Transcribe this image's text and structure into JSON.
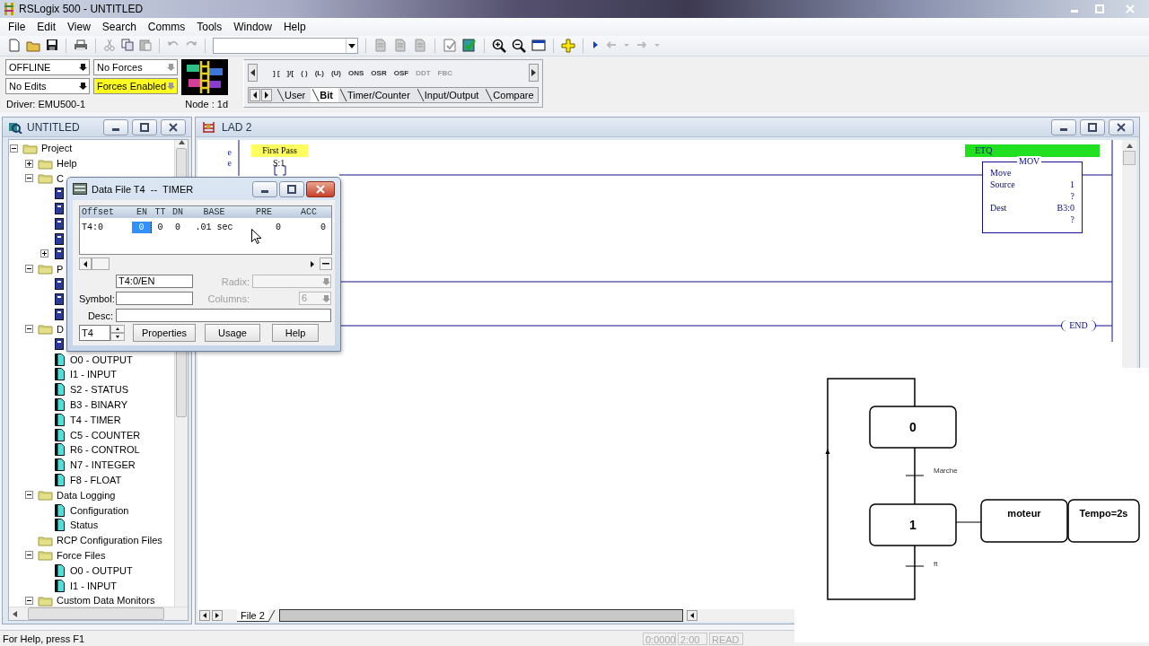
{
  "window": {
    "title": "RSLogix 500 - UNTITLED"
  },
  "menu": [
    "File",
    "Edit",
    "View",
    "Search",
    "Comms",
    "Tools",
    "Window",
    "Help"
  ],
  "status_panel": {
    "dropdowns": [
      {
        "value": "OFFLINE",
        "disabled": false,
        "highlighted": false
      },
      {
        "value": "No Forces",
        "disabled": true,
        "highlighted": false
      },
      {
        "value": "No Edits",
        "disabled": false,
        "highlighted": false
      },
      {
        "value": "Forces Enabled",
        "disabled": true,
        "highlighted": true
      }
    ],
    "driver": "Driver: EMU500-1",
    "node": "Node : 1d"
  },
  "palette": {
    "instructions": [
      {
        "label": "] [",
        "disabled": false
      },
      {
        "label": "]/[",
        "disabled": false
      },
      {
        "label": "( )",
        "disabled": false
      },
      {
        "label": "(L)",
        "disabled": false
      },
      {
        "label": "(U)",
        "disabled": false
      },
      {
        "label": "ONS",
        "disabled": false
      },
      {
        "label": "OSR",
        "disabled": false
      },
      {
        "label": "OSF",
        "disabled": false
      },
      {
        "label": "DDT",
        "disabled": true
      },
      {
        "label": "FBC",
        "disabled": true
      }
    ],
    "tabs": [
      {
        "label": "User",
        "selected": false
      },
      {
        "label": "Bit",
        "selected": true
      },
      {
        "label": "Timer/Counter",
        "selected": false
      },
      {
        "label": "Input/Output",
        "selected": false
      },
      {
        "label": "Compare",
        "selected": false
      }
    ]
  },
  "project_window": {
    "title": "UNTITLED",
    "tree": [
      {
        "label": "Project",
        "kind": "folder",
        "expanded": true,
        "children": [
          {
            "label": "Help",
            "kind": "folder",
            "expanded": false
          },
          {
            "label": "C",
            "kind": "folder",
            "expanded": true,
            "children": [
              {
                "kind": "item"
              },
              {
                "kind": "item"
              },
              {
                "kind": "item"
              },
              {
                "kind": "item"
              },
              {
                "kind": "item",
                "expanded": false
              }
            ]
          },
          {
            "label": "P",
            "kind": "folder",
            "expanded": true,
            "children": [
              {
                "kind": "item"
              },
              {
                "kind": "item"
              },
              {
                "kind": "item"
              }
            ]
          },
          {
            "label": "D",
            "kind": "folder",
            "expanded": true,
            "children": [
              {
                "kind": "item"
              },
              {
                "label": "O0 - OUTPUT",
                "kind": "file"
              },
              {
                "label": "I1 - INPUT",
                "kind": "file"
              },
              {
                "label": "S2 - STATUS",
                "kind": "file"
              },
              {
                "label": "B3 - BINARY",
                "kind": "file"
              },
              {
                "label": "T4 - TIMER",
                "kind": "file"
              },
              {
                "label": "C5 - COUNTER",
                "kind": "file"
              },
              {
                "label": "R6 - CONTROL",
                "kind": "file"
              },
              {
                "label": "N7 - INTEGER",
                "kind": "file"
              },
              {
                "label": "F8 - FLOAT",
                "kind": "file"
              }
            ]
          },
          {
            "label": "Data Logging",
            "kind": "folder",
            "expanded": true,
            "children": [
              {
                "label": "Configuration",
                "kind": "file"
              },
              {
                "label": "Status",
                "kind": "file"
              }
            ]
          },
          {
            "label": "RCP Configuration Files",
            "kind": "folder"
          },
          {
            "label": "Force Files",
            "kind": "folder",
            "expanded": true,
            "children": [
              {
                "label": "O0 - OUTPUT",
                "kind": "file"
              },
              {
                "label": "I1 - INPUT",
                "kind": "file"
              }
            ]
          },
          {
            "label": "Custom Data Monitors",
            "kind": "folder",
            "expanded": true
          }
        ]
      }
    ]
  },
  "ladder_window": {
    "title": "LAD 2",
    "rung_marks": [
      "e",
      "e"
    ],
    "contact": {
      "label": "First Pass",
      "address": "S:1"
    },
    "output": {
      "label": "ETQ",
      "instruction": "MOV",
      "name": "Move",
      "rows": [
        {
          "label": "Source",
          "value": "1"
        },
        {
          "value": "?"
        },
        {
          "label": "Dest",
          "value": "B3:0"
        },
        {
          "value": "?"
        }
      ]
    },
    "end": "END",
    "file_tab": "File 2"
  },
  "data_file_dialog": {
    "title": "Data File T4  --  TIMER",
    "columns": [
      "Offset",
      "EN",
      "TT",
      "DN",
      "BASE",
      "PRE",
      "ACC"
    ],
    "rows": [
      {
        "cells": [
          {
            "text": "T4:0",
            "selected": false
          },
          {
            "text": "0",
            "selected": true
          },
          {
            "text": "0",
            "selected": false
          },
          {
            "text": "0",
            "selected": false
          },
          {
            "text": ".01 sec",
            "selected": false
          },
          {
            "text": "0",
            "selected": false
          },
          {
            "text": "0",
            "selected": false
          }
        ]
      }
    ],
    "address": "T4:0/EN",
    "radix": {
      "label": "Radix:",
      "disabled": true
    },
    "symbol_label": "Symbol:",
    "columns_field": {
      "label": "Columns:",
      "value": "6",
      "disabled": true
    },
    "desc_label": "Desc:",
    "file": "T4",
    "buttons": [
      "Properties",
      "Usage",
      "Help"
    ]
  },
  "grafcet": {
    "steps": [
      "0",
      "1"
    ],
    "transitions": [
      "Marche",
      "ft"
    ],
    "actions": [
      "moteur",
      "Tempo=2s"
    ]
  },
  "status_bar": {
    "help": "For Help, press F1",
    "fields": [
      "0:0000",
      "2:00",
      "READ"
    ]
  }
}
